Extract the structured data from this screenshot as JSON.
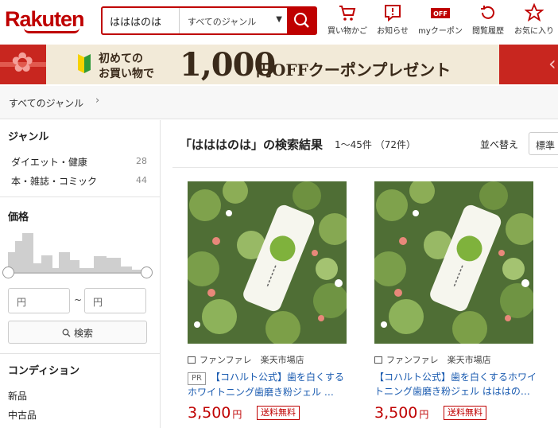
{
  "header": {
    "logo": "Rakuten",
    "search_value": "はははのは",
    "genre_select": "すべてのジャンル",
    "nav": [
      "買い物かご",
      "お知らせ",
      "myクーポン",
      "閲覧履歴",
      "お気に入り"
    ],
    "coupon_icon_text": "OFF"
  },
  "banner": {
    "line1": "初めての",
    "line2": "お買い物で",
    "amount": "1,000",
    "tail": "円OFFクーポンプレゼント"
  },
  "breadcrumb": "すべてのジャンル",
  "sidebar": {
    "genre_title": "ジャンル",
    "genres": [
      {
        "label": "ダイエット・健康",
        "count": "28"
      },
      {
        "label": "本・雑誌・コミック",
        "count": "44"
      }
    ],
    "price_title": "価格",
    "price_min_placeholder": "円",
    "price_max_placeholder": "円",
    "price_separator": "~",
    "price_search": "検索",
    "condition_title": "コンディション",
    "conditions": [
      "新品",
      "中古品"
    ]
  },
  "results": {
    "title": "「はははのは」の検索結果",
    "count": "1〜45件 （72件）",
    "sort_label": "並べ替え",
    "sort_value": "標準"
  },
  "products": [
    {
      "shop": "ファンファレ　楽天市場店",
      "pr": "PR",
      "name": "【コハルト公式】歯を白くするホワイトニング歯磨き粉ジェル …",
      "price": "3,500",
      "yen": "円",
      "shipping": "送料無料"
    },
    {
      "shop": "ファンファレ　楽天市場店",
      "name": "【コハルト公式】歯を白くするホワイトニング歯磨き粉ジェル はははの…",
      "price": "3,500",
      "yen": "円",
      "shipping": "送料無料"
    }
  ],
  "colors": {
    "brand": "#bf0000",
    "link": "#1a5bb0",
    "banner_bg": "#f2ead8"
  }
}
